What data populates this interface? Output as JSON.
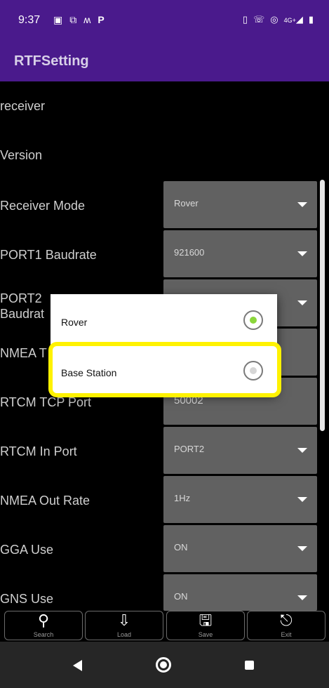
{
  "status_bar": {
    "time": "9:37",
    "left_icons": [
      "image-icon",
      "screenshot-icon",
      "m-icon",
      "p-icon"
    ],
    "right_icons": [
      "vibrate-icon",
      "volte-icon",
      "hotspot-icon",
      "signal-4g-icon",
      "battery-icon"
    ],
    "network_label": "4G+"
  },
  "app_bar": {
    "title": "RTFSetting"
  },
  "settings": [
    {
      "label": "receiver"
    },
    {
      "label": "Version"
    },
    {
      "label": "Receiver Mode",
      "value": "Rover"
    },
    {
      "label": "PORT1 Baudrate",
      "value": "921600"
    },
    {
      "label": "PORT2\nBaudrate",
      "label_visible": "PORT2 Baudrat",
      "value": ""
    },
    {
      "label": "NMEA T",
      "value": ""
    },
    {
      "label": "RTCM TCP Port",
      "value": "50002"
    },
    {
      "label": "RTCM In Port",
      "value": "PORT2"
    },
    {
      "label": "NMEA Out Rate",
      "value": "1Hz"
    },
    {
      "label": "GGA Use",
      "value": "ON"
    },
    {
      "label": "GNS Use",
      "value": "ON"
    }
  ],
  "dialog": {
    "options": [
      {
        "label": "Rover",
        "selected": true
      },
      {
        "label": "Base Station",
        "selected": false
      }
    ],
    "highlight_color": "#fff200",
    "selected_dot_color": "#8bd63b"
  },
  "toolbar": {
    "buttons": [
      {
        "label": "Search",
        "icon": "search-icon",
        "glyph": "⚲"
      },
      {
        "label": "Load",
        "icon": "load-icon",
        "glyph": "⇩"
      },
      {
        "label": "Save",
        "icon": "save-icon",
        "glyph": "🖫"
      },
      {
        "label": "Exit",
        "icon": "exit-icon",
        "glyph": "⎋"
      }
    ]
  },
  "colors": {
    "app_bar": "#4a1a8c",
    "select_bg": "#616161",
    "background": "#000000"
  }
}
